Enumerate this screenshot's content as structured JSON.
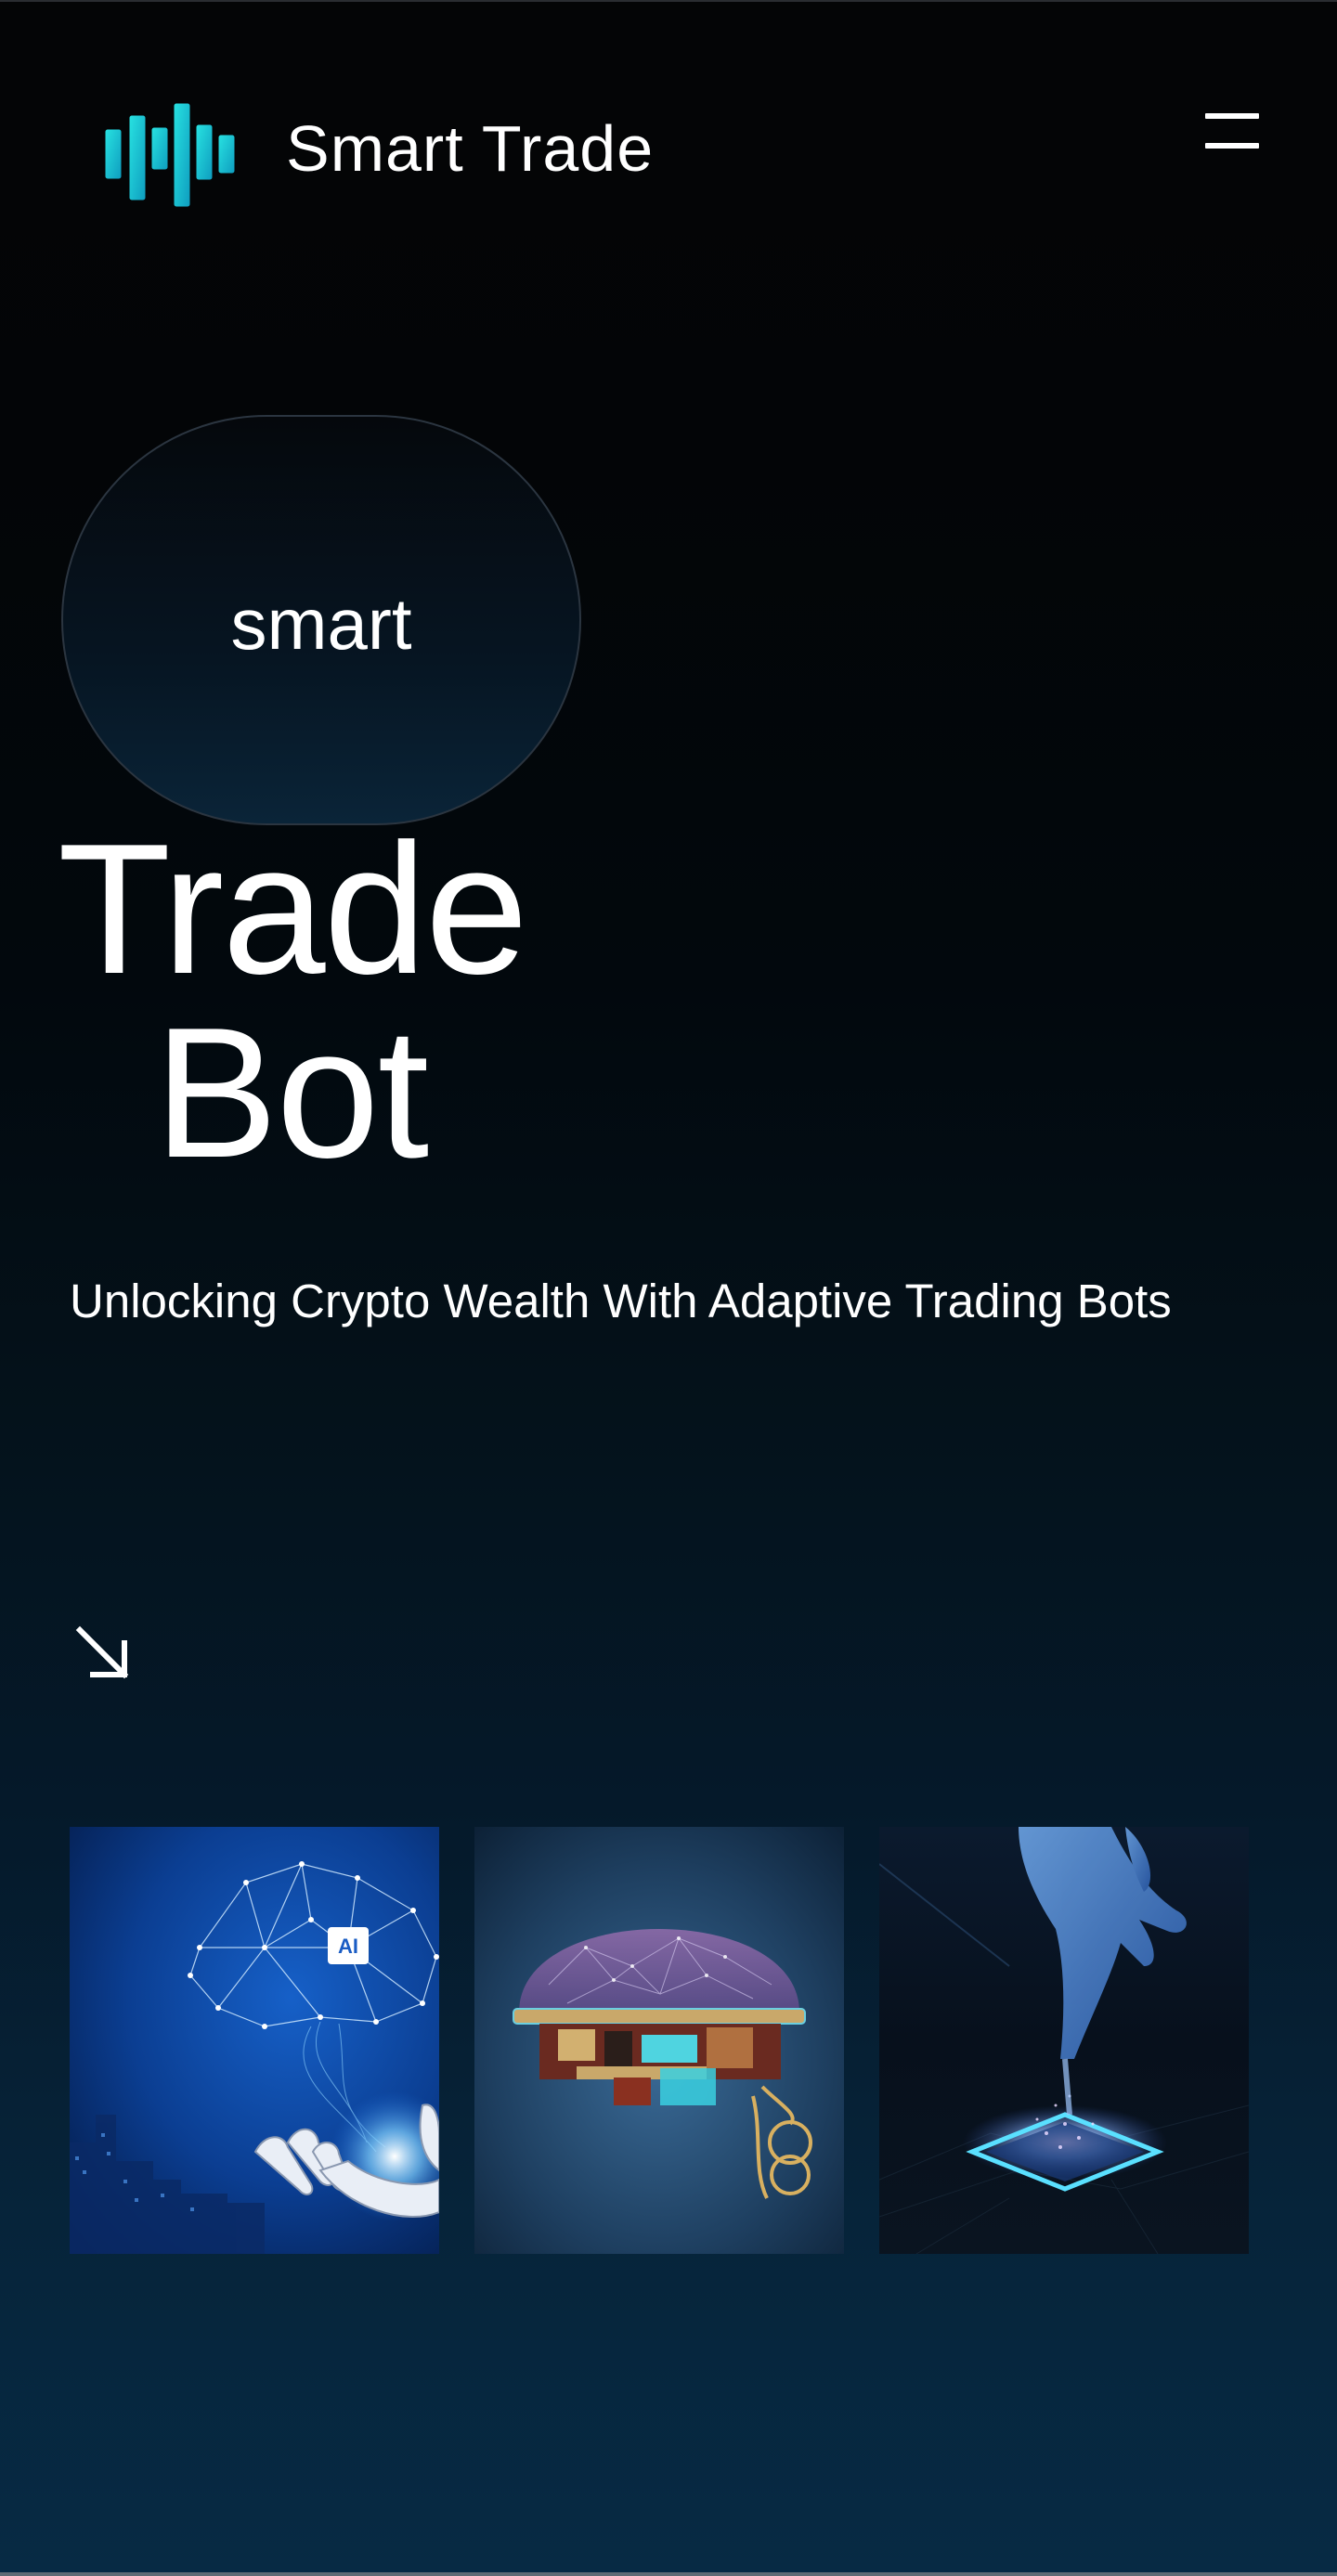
{
  "header": {
    "brand_name": "Smart Trade",
    "logo_icon": "candlestick-logo-icon",
    "menu_icon": "hamburger-menu-icon"
  },
  "hero": {
    "pill_text": "smart",
    "title_line1": "Trade",
    "title_line2": "Bot",
    "tagline": "Unlocking Crypto Wealth With Adaptive Trading Bots",
    "arrow_icon": "arrow-down-right-icon"
  },
  "gallery": {
    "items": [
      {
        "name": "ai-brain-robot-hand-image",
        "badge_text": "AI"
      },
      {
        "name": "dome-brain-circuit-image"
      },
      {
        "name": "hand-touching-chip-image"
      }
    ]
  },
  "colors": {
    "background_top": "#040506",
    "background_bottom": "#072a44",
    "accent_cyan": "#19c8d4",
    "text": "#ffffff"
  }
}
